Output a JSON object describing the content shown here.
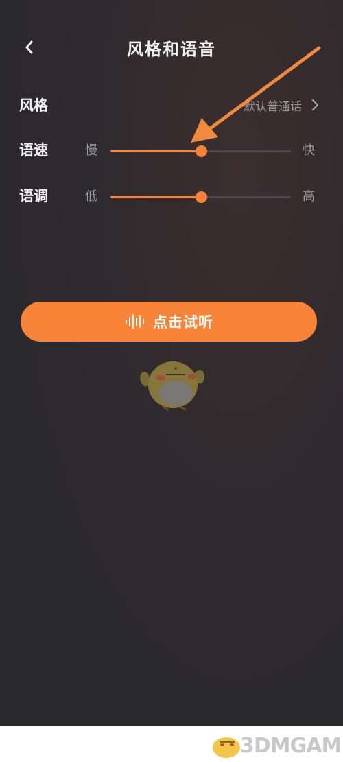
{
  "header": {
    "title": "风格和语音"
  },
  "style_row": {
    "label": "风格",
    "value": "默认普通话"
  },
  "speed_row": {
    "label": "语速",
    "min_label": "慢",
    "max_label": "快",
    "level": 0.5
  },
  "pitch_row": {
    "label": "语调",
    "min_label": "低",
    "max_label": "高",
    "level": 0.5
  },
  "preview": {
    "label": "点击试听"
  },
  "icons": {
    "back": "chevron-left-icon",
    "style_more": "chevron-right-icon",
    "preview": "sound-wave-icon",
    "mascot": "bird-mascot-icon",
    "watermark_logo": "watermark-logo-icon"
  },
  "watermark": {
    "text": "3DMGAME"
  },
  "colors": {
    "accent": "#f7823a",
    "background": "#2a292d",
    "text_primary": "#f0f0f0",
    "text_secondary": "#9e9e9e",
    "track": "#4a4750"
  }
}
